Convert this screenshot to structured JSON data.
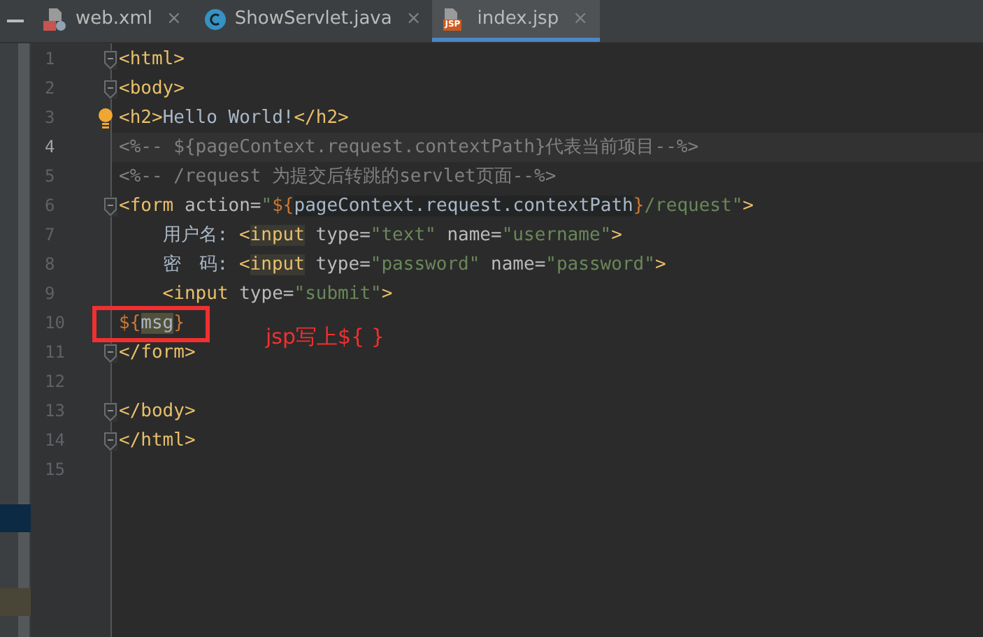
{
  "tabs": [
    {
      "label": "web.xml",
      "close": "×",
      "selected": false
    },
    {
      "label": "ShowServlet.java",
      "close": "×",
      "selected": false
    },
    {
      "label": "index.jsp",
      "badge": "JSP",
      "close": "×",
      "selected": true
    }
  ],
  "editor": {
    "lines": [
      {
        "number": "1",
        "fold": true,
        "current": false,
        "tokens": [
          {
            "kind": "tag",
            "t": "<html>"
          }
        ]
      },
      {
        "number": "2",
        "fold": true,
        "current": false,
        "tokens": [
          {
            "kind": "tag",
            "t": "<body>"
          }
        ]
      },
      {
        "number": "3",
        "fold": false,
        "current": false,
        "bulb": true,
        "tokens": [
          {
            "kind": "tag",
            "t": "<h2>"
          },
          {
            "kind": "text",
            "t": "Hello World!"
          },
          {
            "kind": "tag",
            "t": "</h2>"
          }
        ]
      },
      {
        "number": "4",
        "fold": false,
        "current": true,
        "tokens": [
          {
            "kind": "comment",
            "t": "<%-- ${pageContext.request.contextPath}代表当前项目--%>"
          }
        ]
      },
      {
        "number": "5",
        "fold": false,
        "current": false,
        "tokens": [
          {
            "kind": "comment",
            "t": "<%-- /request 为提交后转跳的servlet页面--%>"
          }
        ]
      },
      {
        "number": "6",
        "fold": true,
        "current": false,
        "tokens": [
          {
            "kind": "tag",
            "t": "<form "
          },
          {
            "kind": "attr",
            "t": "action="
          },
          {
            "kind": "string",
            "t": "\""
          },
          {
            "kind": "el",
            "t": "${"
          },
          {
            "kind": "elbody",
            "t": "pageContext.request.contextPath"
          },
          {
            "kind": "el",
            "t": "}"
          },
          {
            "kind": "string",
            "t": "/request\""
          },
          {
            "kind": "tag",
            "t": ">"
          }
        ]
      },
      {
        "number": "7",
        "fold": false,
        "current": false,
        "tokens": [
          {
            "kind": "text",
            "t": "    用户名: "
          },
          {
            "kind": "tag",
            "t": "<"
          },
          {
            "kind": "taghl",
            "t": "input"
          },
          {
            "kind": "attr",
            "t": " type="
          },
          {
            "kind": "string",
            "t": "\"text\""
          },
          {
            "kind": "attr",
            "t": " name="
          },
          {
            "kind": "string",
            "t": "\"username\""
          },
          {
            "kind": "tag",
            "t": ">"
          }
        ]
      },
      {
        "number": "8",
        "fold": false,
        "current": false,
        "tokens": [
          {
            "kind": "text",
            "t": "    密　码: "
          },
          {
            "kind": "tag",
            "t": "<"
          },
          {
            "kind": "taghl",
            "t": "input"
          },
          {
            "kind": "attr",
            "t": " type="
          },
          {
            "kind": "string",
            "t": "\"password\""
          },
          {
            "kind": "attr",
            "t": " name="
          },
          {
            "kind": "string",
            "t": "\"password\""
          },
          {
            "kind": "tag",
            "t": ">"
          }
        ]
      },
      {
        "number": "9",
        "fold": false,
        "current": false,
        "tokens": [
          {
            "kind": "tag",
            "t": "    <input"
          },
          {
            "kind": "attr",
            "t": " type="
          },
          {
            "kind": "string",
            "t": "\"submit\""
          },
          {
            "kind": "tag",
            "t": ">"
          }
        ]
      },
      {
        "number": "10",
        "fold": false,
        "current": false,
        "tokens": [
          {
            "kind": "el",
            "t": "${"
          },
          {
            "kind": "elhl",
            "t": "msg"
          },
          {
            "kind": "el",
            "t": "}"
          }
        ]
      },
      {
        "number": "11",
        "fold": true,
        "current": false,
        "tokens": [
          {
            "kind": "tag",
            "t": "</form>"
          }
        ]
      },
      {
        "number": "12",
        "fold": false,
        "current": false
      },
      {
        "number": "13",
        "fold": true,
        "current": false,
        "tokens": [
          {
            "kind": "tag",
            "t": "</body>"
          }
        ]
      },
      {
        "number": "14",
        "fold": true,
        "current": false,
        "tokens": [
          {
            "kind": "tag",
            "t": "</html>"
          }
        ]
      },
      {
        "number": "15",
        "fold": false,
        "current": false
      }
    ]
  },
  "annotation": {
    "note": "jsp写上${ }"
  }
}
